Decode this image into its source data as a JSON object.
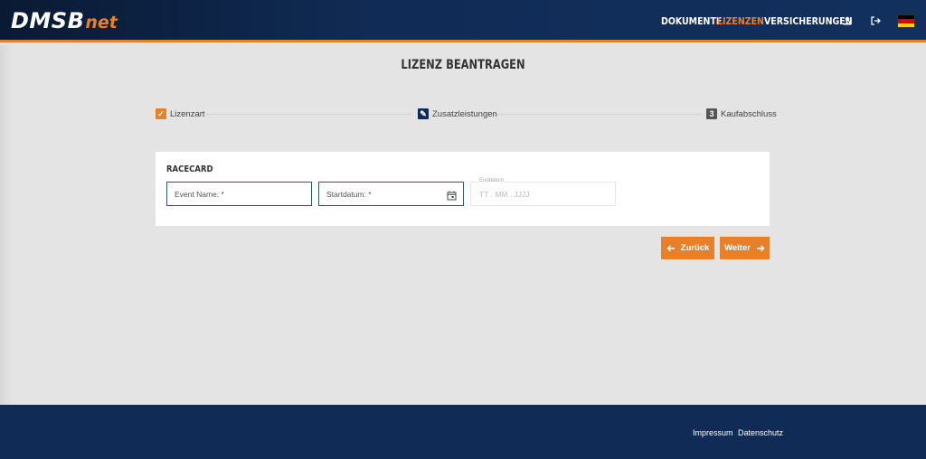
{
  "header": {
    "logo_main": "DMSB",
    "logo_net": "net",
    "nav": [
      {
        "label": "DOKUMENTE",
        "active": false
      },
      {
        "label": "LIZENZEN",
        "active": true
      },
      {
        "label": "VERSICHERUNGEN",
        "active": false
      }
    ],
    "icons": [
      "user-icon",
      "logout-icon",
      "german-flag-icon"
    ],
    "accent_color": "#e8802a",
    "bg_color": "#102b55"
  },
  "page_title": "LIZENZ BEANTRAGEN",
  "stepper": {
    "steps": [
      {
        "label": "Lizenzart",
        "state": "done",
        "marker": "✓"
      },
      {
        "label": "Zusatzleistungen",
        "state": "active",
        "marker": "✎"
      },
      {
        "label": "Kaufabschluss",
        "state": "pending",
        "marker": "3"
      }
    ]
  },
  "card": {
    "title": "RACECARD",
    "fields": {
      "event_name_label": "Event Name: *",
      "start_date_label": "Startdatum: *",
      "end_date_label": "Enddatum",
      "end_date_placeholder": "TT . MM . JJJJ"
    }
  },
  "buttons": {
    "back_label": "Zurück",
    "next_label": "Weiter"
  },
  "footer": {
    "links": [
      "Impressum",
      "Datenschutz"
    ]
  }
}
